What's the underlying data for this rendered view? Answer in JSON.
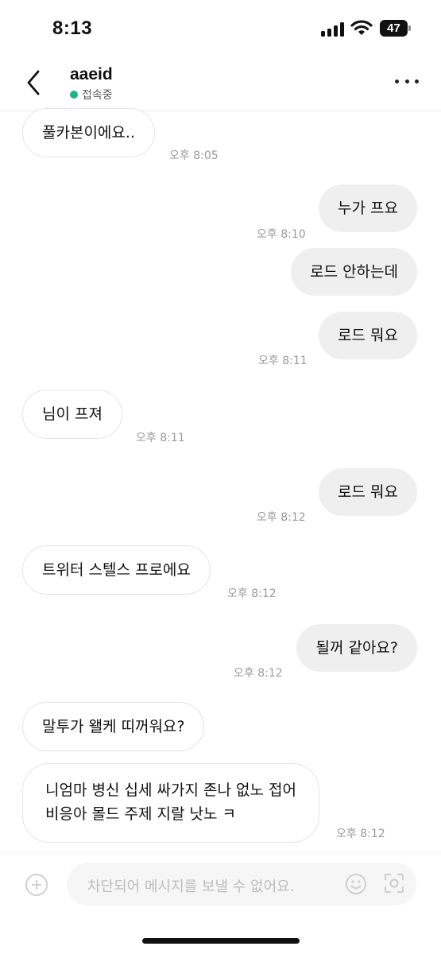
{
  "status_bar": {
    "time": "8:13",
    "battery": "47"
  },
  "header": {
    "name": "aaeid",
    "presence": "접속중"
  },
  "messages": [
    {
      "dir": "in",
      "text": "풀카본이에요..",
      "time": "오후 8:05"
    },
    {
      "dir": "out",
      "text": "누가 프요",
      "time": "오후 8:10"
    },
    {
      "dir": "out",
      "text": "로드 안하는데",
      "time": ""
    },
    {
      "dir": "out",
      "text": "로드 뭐요",
      "time": "오후 8:11"
    },
    {
      "dir": "in",
      "text": "님이 프져",
      "time": "오후 8:11"
    },
    {
      "dir": "out",
      "text": "로드 뭐요",
      "time": "오후 8:12"
    },
    {
      "dir": "in",
      "text": "트위터 스텔스 프로에요",
      "time": "오후 8:12"
    },
    {
      "dir": "out",
      "text": "될꺼 같아요?",
      "time": "오후 8:12"
    },
    {
      "dir": "in",
      "text": "말투가 왤케 띠꺼워요?",
      "time": ""
    },
    {
      "dir": "in",
      "line1": "니엄마 병신 십세 싸가지 존나 없노 접어",
      "line2": "비응아 몰드 주제 지랄 낫노 ㅋ",
      "time": "오후 8:12"
    }
  ],
  "composer": {
    "placeholder": "차단되어 메시지를 보낼 수 없어요."
  },
  "icons": {
    "back": "chevron-left-icon",
    "more": "more-horizontal-icon",
    "add": "plus-circle-icon",
    "emoji": "emoji-icon",
    "camera": "camera-scan-icon"
  },
  "colors": {
    "online": "#19b38a",
    "outgoing_bubble": "#efefef"
  }
}
